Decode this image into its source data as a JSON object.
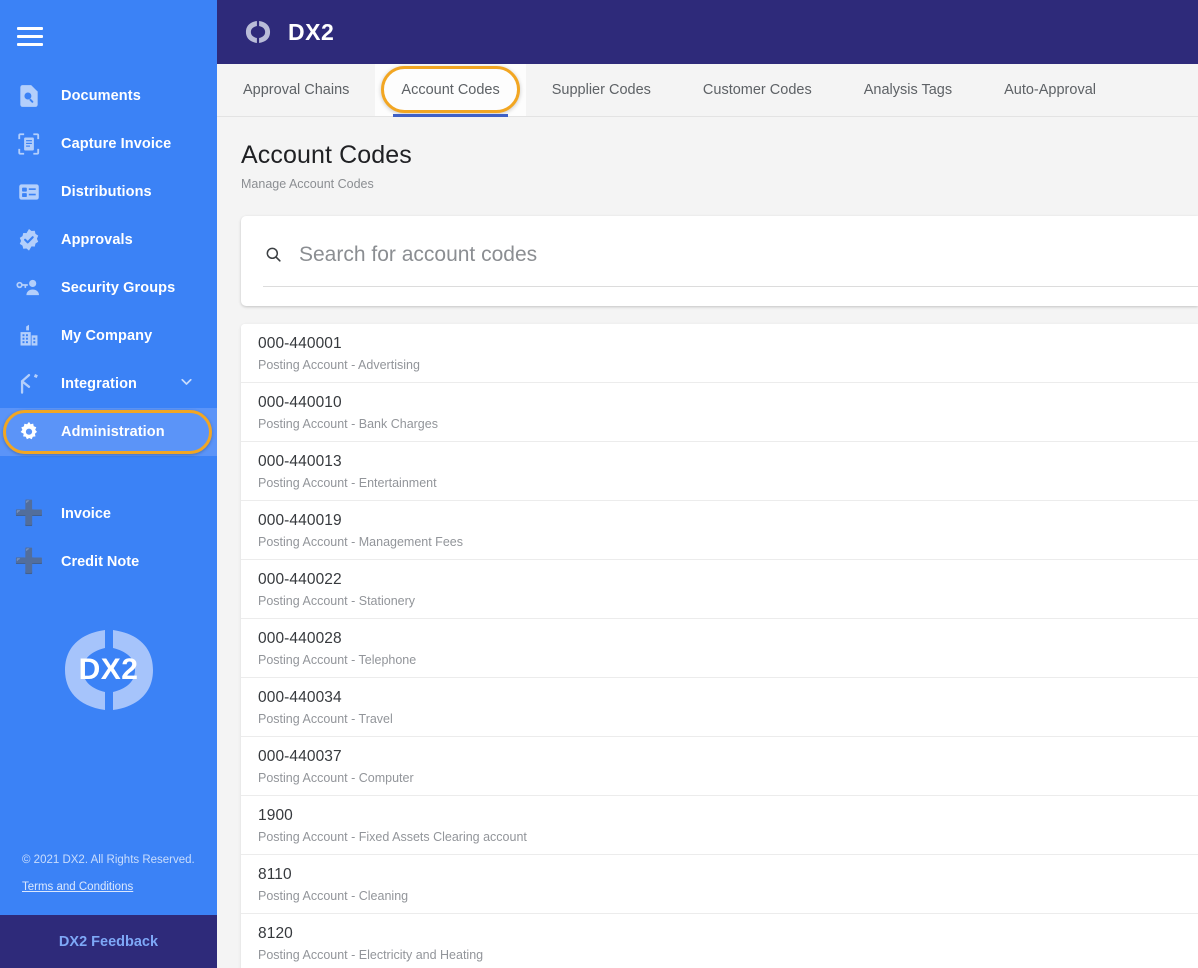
{
  "brand": {
    "name": "DX2",
    "logo_icon": "dx2-parentheses-logo"
  },
  "sidebar": {
    "menu_icon": "hamburger-icon",
    "items": [
      {
        "label": "Documents",
        "icon": "document-search-icon",
        "active": false
      },
      {
        "label": "Capture Invoice",
        "icon": "document-scan-icon",
        "active": false
      },
      {
        "label": "Distributions",
        "icon": "list-card-icon",
        "active": false
      },
      {
        "label": "Approvals",
        "icon": "badge-check-icon",
        "active": false
      },
      {
        "label": "Security Groups",
        "icon": "user-key-icon",
        "active": false
      },
      {
        "label": "My Company",
        "icon": "office-building-icon",
        "active": false
      },
      {
        "label": "Integration",
        "icon": "branch-merge-icon",
        "active": false,
        "expand_icon": "chevron-down-icon"
      },
      {
        "label": "Administration",
        "icon": "gear-icon",
        "active": true,
        "highlighted": true
      }
    ],
    "actions": [
      {
        "label": "Invoice",
        "icon": "plus-icon"
      },
      {
        "label": "Credit Note",
        "icon": "plus-icon"
      }
    ],
    "logo_text": "DX2",
    "copyright": "© 2021 DX2. All Rights Reserved.",
    "terms_link": "Terms and Conditions",
    "feedback_button": "DX2 Feedback"
  },
  "tabs": [
    {
      "label": "Approval Chains",
      "selected": false
    },
    {
      "label": "Account Codes",
      "selected": true
    },
    {
      "label": "Supplier Codes",
      "selected": false
    },
    {
      "label": "Customer Codes",
      "selected": false
    },
    {
      "label": "Analysis Tags",
      "selected": false
    },
    {
      "label": "Auto-Approval",
      "selected": false
    }
  ],
  "page": {
    "title": "Account Codes",
    "subtitle": "Manage Account Codes"
  },
  "search": {
    "placeholder": "Search for account codes",
    "value": "",
    "icon": "search-icon"
  },
  "account_codes": [
    {
      "code": "000-440001",
      "description": "Posting Account - Advertising"
    },
    {
      "code": "000-440010",
      "description": "Posting Account - Bank Charges"
    },
    {
      "code": "000-440013",
      "description": "Posting Account - Entertainment"
    },
    {
      "code": "000-440019",
      "description": "Posting Account - Management Fees"
    },
    {
      "code": "000-440022",
      "description": "Posting Account - Stationery"
    },
    {
      "code": "000-440028",
      "description": "Posting Account - Telephone"
    },
    {
      "code": "000-440034",
      "description": "Posting Account - Travel"
    },
    {
      "code": "000-440037",
      "description": "Posting Account - Computer"
    },
    {
      "code": "1900",
      "description": "Posting Account - Fixed Assets Clearing account"
    },
    {
      "code": "8110",
      "description": "Posting Account - Cleaning"
    },
    {
      "code": "8120",
      "description": "Posting Account - Electricity and Heating"
    }
  ],
  "colors": {
    "sidebar_blue": "#3b82f6",
    "sidebar_active_blue": "#5b94f8",
    "header_navy": "#2e2a7a",
    "highlight_orange": "#f2a622",
    "tab_underline_blue": "#3f61c6",
    "page_background": "#f4f4f4"
  }
}
